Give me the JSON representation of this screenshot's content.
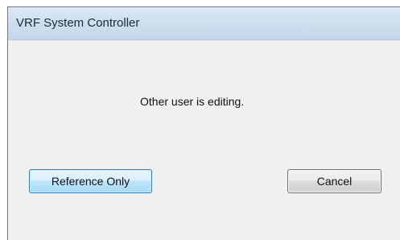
{
  "window": {
    "title": "VRF System Controller"
  },
  "dialog": {
    "message": "Other user is editing."
  },
  "buttons": {
    "reference_only": "Reference Only",
    "cancel": "Cancel"
  }
}
